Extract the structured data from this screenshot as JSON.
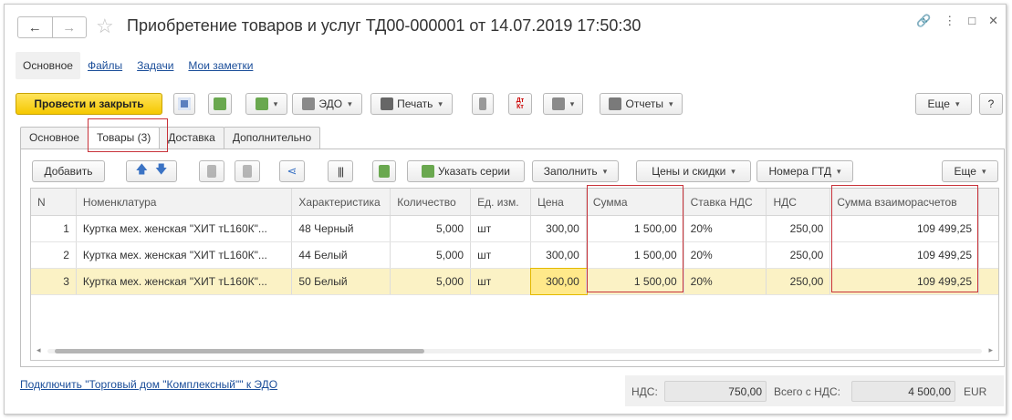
{
  "window": {
    "title": "Приобретение товаров и услуг ТД00-000001 от 14.07.2019 17:50:30",
    "nav_back": "←",
    "nav_forward": "→"
  },
  "nav_tabs": [
    {
      "label": "Основное"
    },
    {
      "label": "Файлы"
    },
    {
      "label": "Задачи"
    },
    {
      "label": "Мои заметки"
    }
  ],
  "toolbar": {
    "post_close": "Провести и закрыть",
    "edo": "ЭДО",
    "print": "Печать",
    "dtkt_top": "Дт",
    "dtkt_bottom": "Кт",
    "reports": "Отчеты",
    "more": "Еще",
    "help": "?"
  },
  "doc_tabs": [
    {
      "label": "Основное"
    },
    {
      "label": "Товары (3)"
    },
    {
      "label": "Доставка"
    },
    {
      "label": "Дополнительно"
    }
  ],
  "table_toolbar": {
    "add": "Добавить",
    "series": "Указать серии",
    "fill": "Заполнить",
    "prices": "Цены и скидки",
    "gtd": "Номера ГТД",
    "more": "Еще"
  },
  "table": {
    "columns": [
      "N",
      "Номенклатура",
      "Характеристика",
      "Количество",
      "Ед. изм.",
      "Цена",
      "Сумма",
      "Ставка НДС",
      "НДС",
      "Сумма взаиморасчетов"
    ],
    "rows": [
      {
        "n": "1",
        "nom": "Куртка мех. женская \"ХИТ тL160К\"...",
        "char": "48 Черный",
        "qty": "5,000",
        "unit": "шт",
        "price": "300,00",
        "sum": "1 500,00",
        "vat_rate": "20%",
        "vat": "250,00",
        "total": "109 499,25"
      },
      {
        "n": "2",
        "nom": "Куртка мех. женская \"ХИТ тL160К\"...",
        "char": "44 Белый",
        "qty": "5,000",
        "unit": "шт",
        "price": "300,00",
        "sum": "1 500,00",
        "vat_rate": "20%",
        "vat": "250,00",
        "total": "109 499,25"
      },
      {
        "n": "3",
        "nom": "Куртка мех. женская \"ХИТ тL160К\"...",
        "char": "50 Белый",
        "qty": "5,000",
        "unit": "шт",
        "price": "300,00",
        "sum": "1 500,00",
        "vat_rate": "20%",
        "vat": "250,00",
        "total": "109 499,25"
      }
    ]
  },
  "footer": {
    "edo_link": "Подключить \"Торговый дом \"Комплексный\"\" к ЭДО",
    "vat_label": "НДС:",
    "vat_value": "750,00",
    "total_label": "Всего с НДС:",
    "total_value": "4 500,00",
    "currency": "EUR"
  },
  "colors": {
    "primary_button": "#f5c800",
    "link": "#1a4d99",
    "highlight": "#c8323a",
    "selected_row": "#fbf2c5"
  }
}
